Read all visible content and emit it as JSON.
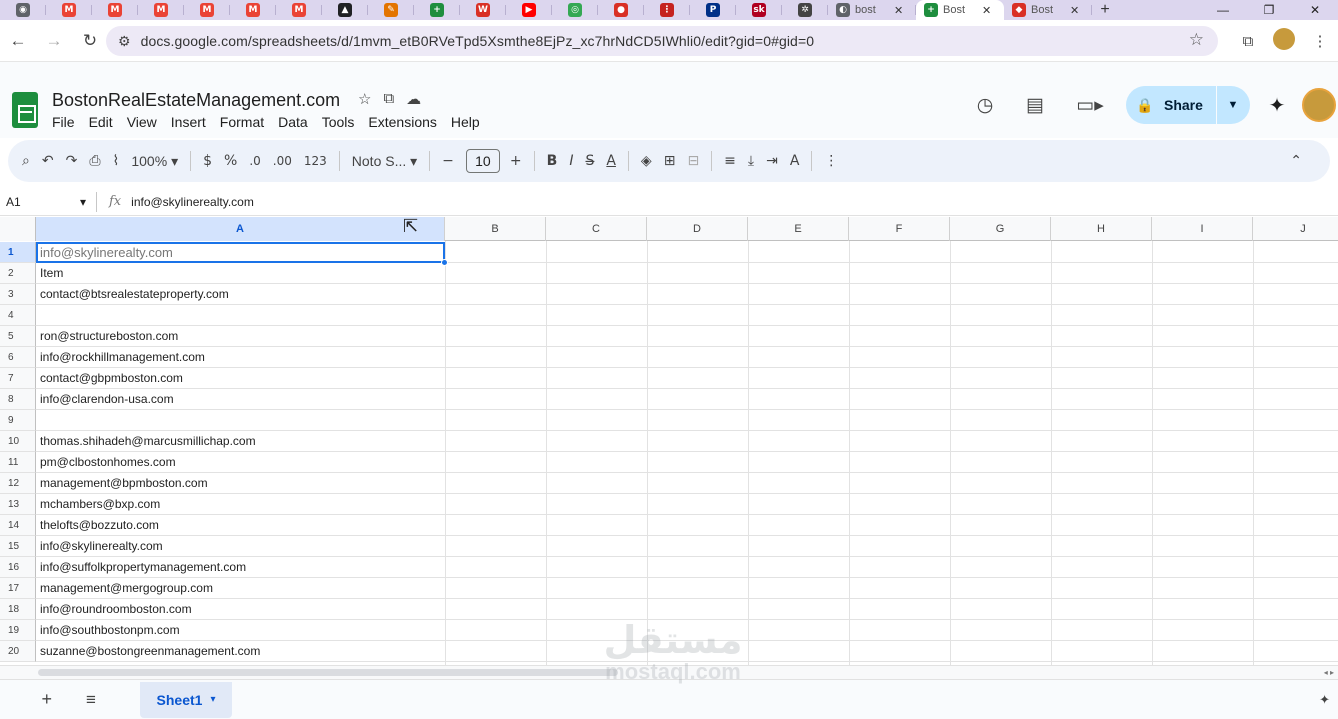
{
  "browser": {
    "tabs": [
      {
        "icon": "chrome-icon",
        "color": "#5f6368",
        "glyph": "◉"
      },
      {
        "icon": "gmail-icon",
        "color": "#ea4335",
        "glyph": "M"
      },
      {
        "icon": "gmail-icon",
        "color": "#ea4335",
        "glyph": "M"
      },
      {
        "icon": "gmail-icon",
        "color": "#ea4335",
        "glyph": "M"
      },
      {
        "icon": "gmail-icon",
        "color": "#ea4335",
        "glyph": "M"
      },
      {
        "icon": "gmail-icon",
        "color": "#ea4335",
        "glyph": "M"
      },
      {
        "icon": "gmail-icon",
        "color": "#ea4335",
        "glyph": "M"
      },
      {
        "icon": "app-triangle-icon",
        "color": "#202124",
        "glyph": "▲"
      },
      {
        "icon": "tool-icon",
        "color": "#e37400",
        "glyph": "✎"
      },
      {
        "icon": "sheets-icon",
        "color": "#1e8e3e",
        "glyph": "+"
      },
      {
        "icon": "word-icon",
        "color": "#d93025",
        "glyph": "W"
      },
      {
        "icon": "youtube-icon",
        "color": "#ff0000",
        "glyph": "▶"
      },
      {
        "icon": "app-green-icon",
        "color": "#34a853",
        "glyph": "◎"
      },
      {
        "icon": "shield-app-icon",
        "color": "#d93025",
        "glyph": "●"
      },
      {
        "icon": "dots-icon",
        "color": "#c5221f",
        "glyph": "⋮"
      },
      {
        "icon": "paypal-icon",
        "color": "#003087",
        "glyph": "P"
      },
      {
        "icon": "sk-icon",
        "color": "#b00020",
        "glyph": "sk"
      },
      {
        "icon": "openai-icon",
        "color": "#444444",
        "glyph": "✲"
      }
    ],
    "wide_tabs": [
      {
        "icon": "search-tab-icon",
        "color": "#5f6368",
        "glyph": "◐",
        "label": "bost",
        "close": "✕",
        "active": false
      },
      {
        "icon": "sheets-tab-icon",
        "color": "#1e8e3e",
        "glyph": "+",
        "label": "Bost",
        "close": "✕",
        "active": true
      },
      {
        "icon": "app-red-icon",
        "color": "#d93025",
        "glyph": "◆",
        "label": "Bost",
        "close": "✕",
        "active": false
      }
    ],
    "new_tab": "+",
    "window_controls": [
      "—",
      "❐",
      "✕"
    ],
    "back": "←",
    "forward": "→",
    "reload": "↻",
    "site_info": "⚙",
    "url": "docs.google.com/spreadsheets/d/1mvm_etB0RVeTpd5Xsmthe8EjPz_xc7hrNdCD5IWhli0/edit?gid=0#gid=0",
    "bookmark": "☆",
    "extensions": "⧉",
    "menu": "⋮"
  },
  "docs": {
    "title": "BostonRealEstateManagement.com",
    "title_icons": [
      "☆",
      "⧉",
      "☁"
    ],
    "menu": [
      "File",
      "Edit",
      "View",
      "Insert",
      "Format",
      "Data",
      "Tools",
      "Extensions",
      "Help"
    ],
    "history_icon": "◷",
    "comments_icon": "▤",
    "meet_icon": "▭▸",
    "share_label": "Share",
    "share_lock": "🔒",
    "share_arrow": "▼",
    "gemini_icon": "✦"
  },
  "toolbar": {
    "search": "⌕",
    "undo": "↶",
    "redo": "↷",
    "print": "⎙",
    "paint_format": "⌇",
    "zoom": "100%",
    "zoom_arrow": "▾",
    "currency": "$",
    "percent": "%",
    "decrease_decimal": ".0",
    "increase_decimal": ".00",
    "more_formats": "123",
    "font": "Noto S...",
    "font_arrow": "▾",
    "minus": "−",
    "font_size": "10",
    "plus": "+",
    "bold": "B",
    "italic": "I",
    "strike": "S̶",
    "text_color": "A",
    "fill": "◈",
    "borders": "⊞",
    "merge": "⊟",
    "align": "≡",
    "valign": "⤓",
    "wrap": "⇥",
    "rotate": "A",
    "more": "⋮",
    "collapse": "⌃"
  },
  "formula_bar": {
    "cell_ref": "A1",
    "cell_ref_arrow": "▾",
    "fx": "fx",
    "value": "info@skylinerealty.com"
  },
  "grid": {
    "columns": [
      "A",
      "B",
      "C",
      "D",
      "E",
      "F",
      "G",
      "H",
      "I",
      "J"
    ],
    "rows": [
      {
        "num": "1",
        "a": "info@skylinerealty.com"
      },
      {
        "num": "2",
        "a": "Item"
      },
      {
        "num": "3",
        "a": "contact@btsrealestateproperty.com"
      },
      {
        "num": "4",
        "a": ""
      },
      {
        "num": "5",
        "a": "ron@structureboston.com"
      },
      {
        "num": "6",
        "a": "info@rockhillmanagement.com"
      },
      {
        "num": "7",
        "a": "contact@gbpmboston.com"
      },
      {
        "num": "8",
        "a": "info@clarendon-usa.com"
      },
      {
        "num": "9",
        "a": ""
      },
      {
        "num": "10",
        "a": "thomas.shihadeh@marcusmillichap.com"
      },
      {
        "num": "11",
        "a": "pm@clbostonhomes.com"
      },
      {
        "num": "12",
        "a": "management@bpmboston.com"
      },
      {
        "num": "13",
        "a": "mchambers@bxp.com"
      },
      {
        "num": "14",
        "a": "thelofts@bozzuto.com"
      },
      {
        "num": "15",
        "a": "info@skylinerealty.com"
      },
      {
        "num": "16",
        "a": "info@suffolkpropertymanagement.com"
      },
      {
        "num": "17",
        "a": "management@mergogroup.com"
      },
      {
        "num": "18",
        "a": "info@roundroomboston.com"
      },
      {
        "num": "19",
        "a": "info@southbostonpm.com"
      },
      {
        "num": "20",
        "a": "suzanne@bostongreenmanagement.com"
      }
    ]
  },
  "sheets": {
    "add": "+",
    "all": "≡",
    "active_sheet": "Sheet1",
    "sheet_arrow": "▾",
    "explore": "✦"
  },
  "watermark": {
    "arabic": "مستقل",
    "latin": "mostaql.com"
  }
}
